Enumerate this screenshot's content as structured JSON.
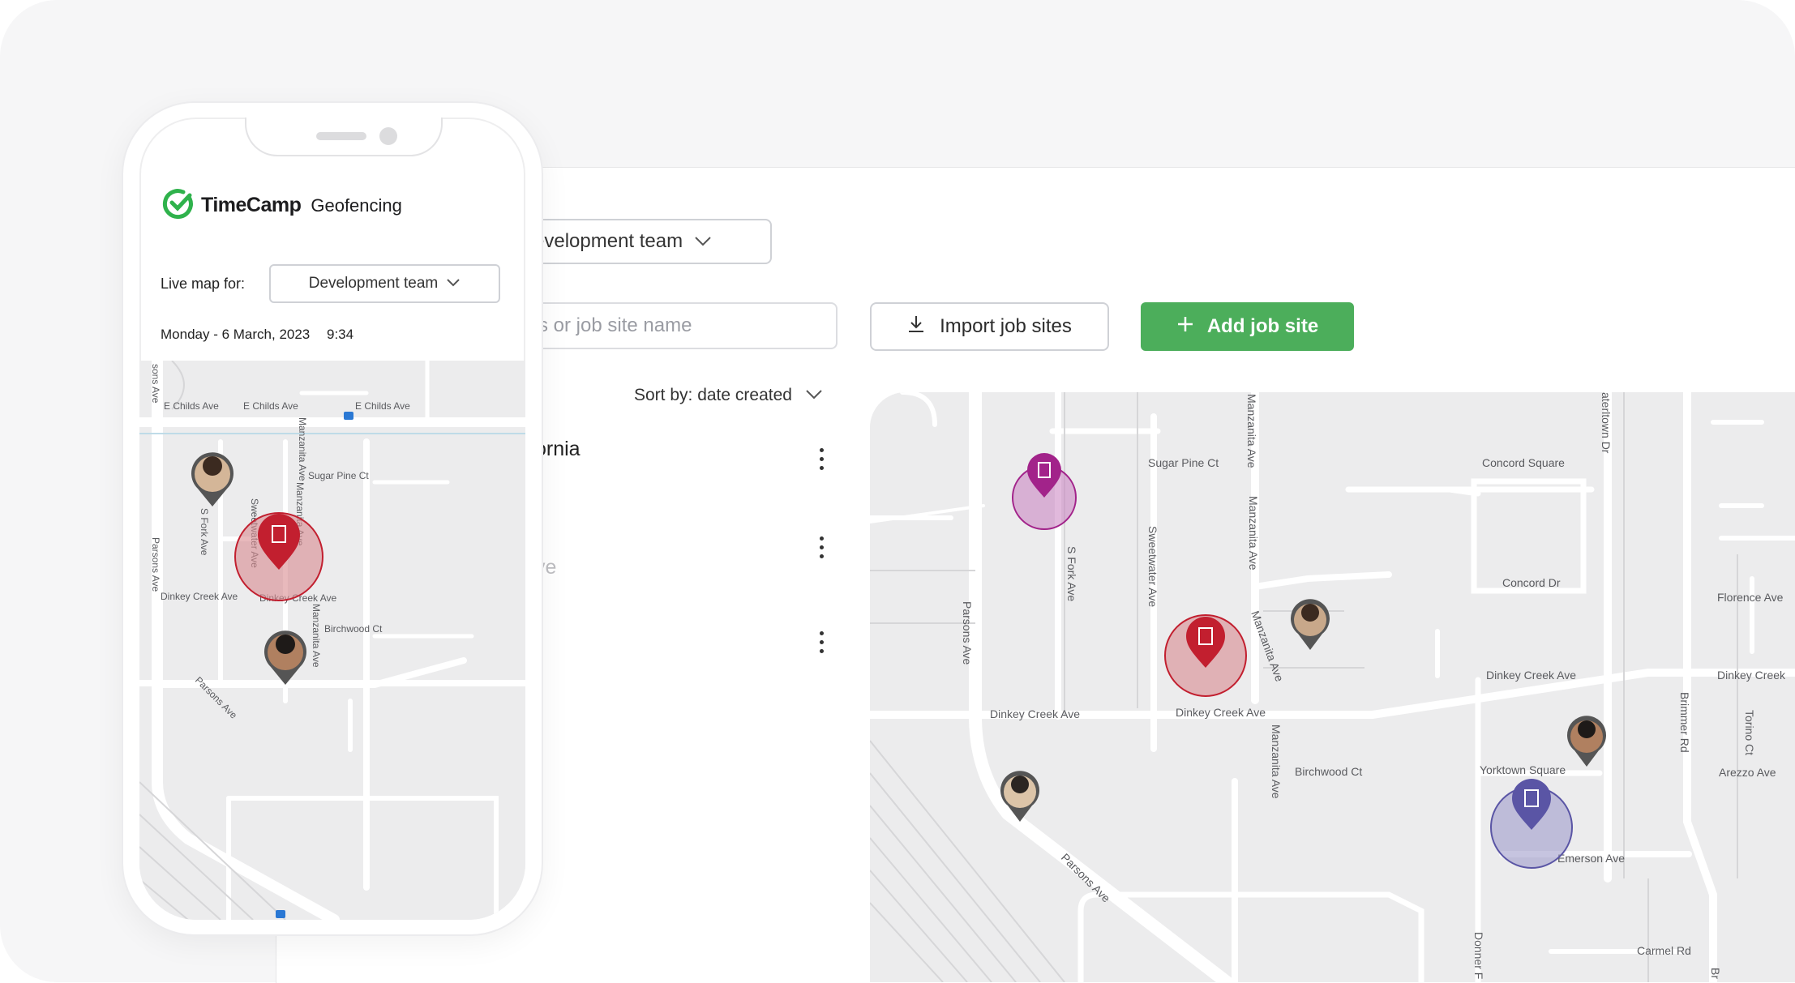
{
  "desktop": {
    "team_select_label": "evelopment team",
    "search_placeholder": "s or job site name",
    "import_button_label": "Import job sites",
    "add_button_label": "Add job site",
    "sort_label": "Sort by: date created",
    "site_items": [
      {
        "label": "ornia"
      },
      {
        "label": "ve"
      },
      {
        "label": ""
      }
    ]
  },
  "map_right": {
    "streets": [
      "Sugar Pine Ct",
      "Concord Square",
      "Concord Dr",
      "Florence Ave",
      "Dinkey Creek Ave",
      "Dinkey Creek Ave",
      "Dinkey Creek Ave",
      "Dinkey Creek",
      "Birchwood Ct",
      "Yorktown Square",
      "Arezzo Ave",
      "Emerson Ave",
      "Carmel Rd",
      "Parsons Ave",
      "Parsons Ave",
      "S Fork Ave",
      "Sweetwater Ave",
      "Manzanita Ave",
      "Manzanita Ave",
      "Manzanita Ave",
      "Manzanita Ave",
      "aterltown Dr",
      "Brimmer Rd",
      "Torino Ct",
      "Donner F",
      "Br"
    ],
    "zone_colors": {
      "magenta": "#a2238a",
      "red": "#c21f2f",
      "purple": "#5a55a5"
    }
  },
  "phone": {
    "brand_name": "TimeCamp",
    "brand_sub": "Geofencing",
    "live_map_label": "Live map for:",
    "team_select_label": "Development team",
    "date": "Monday - 6 March, 2023",
    "time": "9:34",
    "map_streets": [
      "E Childs Ave",
      "E Childs Ave",
      "E Childs Ave",
      "Manzanita Ave",
      "Sugar Pine Ct",
      "S Fork Ave",
      "Sweetwater Ave",
      "Manzanita Ave",
      "Parsons Ave",
      "Dinkey Creek Ave",
      "Dinkey Creek Ave",
      "Manzanita Ave",
      "Birchwood Ct",
      "Parsons Ave",
      "sons Ave"
    ]
  },
  "colors": {
    "accent_green": "#4cae5b",
    "brand_green": "#2fb24c"
  }
}
